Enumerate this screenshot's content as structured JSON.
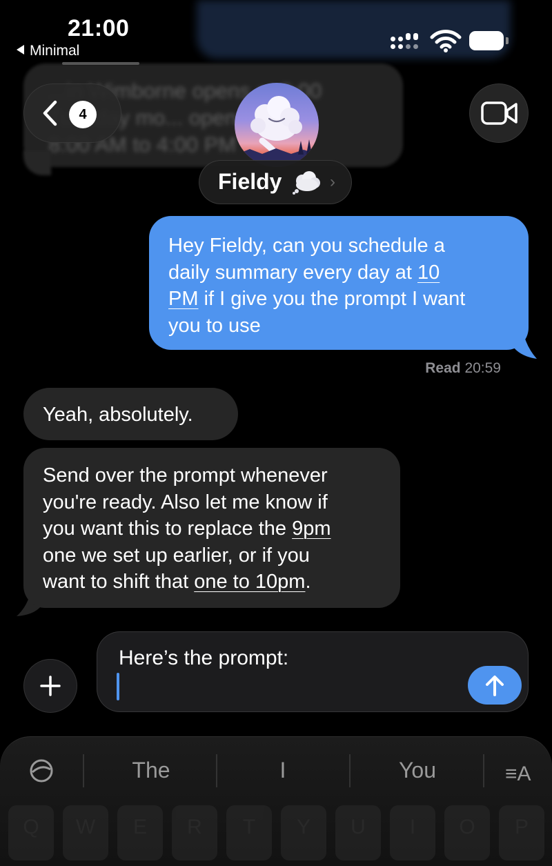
{
  "status_bar": {
    "time": "21:00",
    "back_app": "Minimal"
  },
  "background_message": {
    "text": "...in Wimborne opens at 8:00\nTuesday mo... open\n8:00 AM to 4:00 PM"
  },
  "header": {
    "unread_count": "4",
    "contact_name": "Fieldy",
    "contact_chevron": "›"
  },
  "messages": {
    "outgoing": {
      "line1": "Hey Fieldy, can you schedule a",
      "line2_pre": "daily summary every day at ",
      "line2_link": "10",
      "line3_link": "PM",
      "line3_post": " if I give you the prompt I want",
      "line4": "you to use"
    },
    "read_label": "Read",
    "read_time": "20:59",
    "incoming1": "Yeah, absolutely.",
    "incoming2": {
      "line1": "Send over the prompt whenever",
      "line2": "you're ready. Also let me know if",
      "line3_pre": "you want this to replace the ",
      "line3_link": "9pm",
      "line4": "one we set up earlier, or if you",
      "line5_pre": "want to shift that ",
      "line5_link": "one to 10pm",
      "line5_post": "."
    }
  },
  "composer": {
    "text": "Here’s the prompt:"
  },
  "keyboard": {
    "suggestions": [
      "The",
      "I",
      "You"
    ],
    "format_icon": "≡A",
    "keys": [
      "Q",
      "W",
      "E",
      "R",
      "T",
      "Y",
      "U",
      "I",
      "O",
      "P"
    ]
  },
  "colors": {
    "outgoing_bubble": "#4f94ef",
    "incoming_bubble": "#262626",
    "background": "#000000"
  }
}
